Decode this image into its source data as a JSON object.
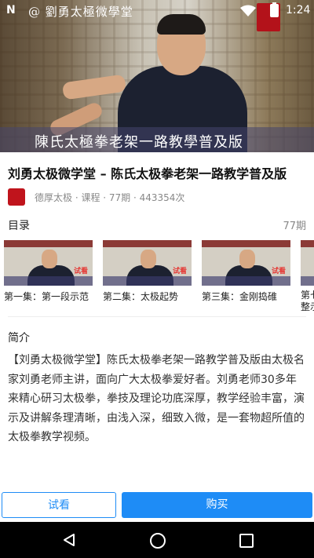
{
  "status_bar": {
    "watermark": "@ 劉勇太極微學堂",
    "time": "1:24"
  },
  "hero": {
    "caption": "陳氏太極拳老架一路教學普及版"
  },
  "course": {
    "title": "刘勇太极微学堂 – 陈氏太极拳老架一路教学普及版",
    "meta": "德厚太极 · 课程 · 77期 · 443354次"
  },
  "toc": {
    "heading": "目录",
    "count": "77期",
    "trial_badge": "试看",
    "episodes": [
      "第一集：第一段示范",
      "第二集：太极起势",
      "第三集：金刚捣碓",
      "第七",
      "整示"
    ]
  },
  "intro": {
    "heading": "简介",
    "body": "【刘勇太极微学堂】陈氏太极拳老架一路教学普及版由太极名家刘勇老师主讲，面向广大太极拳爱好者。刘勇老师30多年来精心研习太极拳，拳技及理论功底深厚，教学经验丰富，演示及讲解条理清晰，由浅入深，细致入微，是一套物超所值的太极拳教学视频。"
  },
  "actions": {
    "trial_label": "试看",
    "buy_label": "购买"
  },
  "colors": {
    "accent": "#1e8cf6",
    "trial_red": "#e53935",
    "brand_red": "#c0141c"
  }
}
